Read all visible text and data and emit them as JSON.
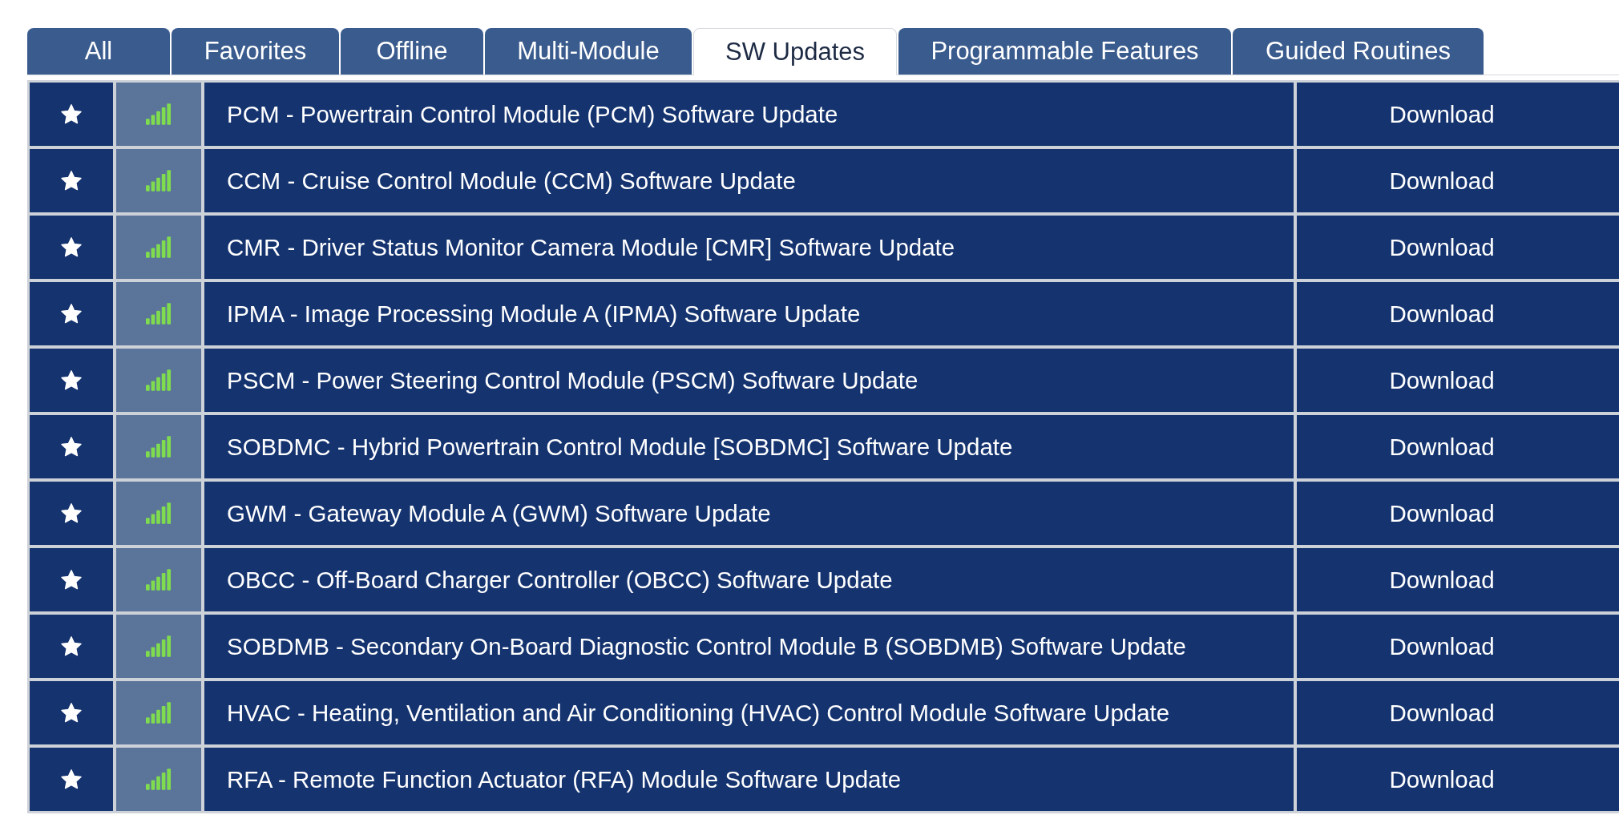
{
  "tabs": [
    {
      "label": "All",
      "selected": false
    },
    {
      "label": "Favorites",
      "selected": false
    },
    {
      "label": "Offline",
      "selected": false
    },
    {
      "label": "Multi-Module",
      "selected": false
    },
    {
      "label": "SW Updates",
      "selected": true
    },
    {
      "label": "Programmable Features",
      "selected": false
    },
    {
      "label": "Guided Routines",
      "selected": false
    }
  ],
  "rows": [
    {
      "name": "PCM - Powertrain Control Module (PCM) Software Update",
      "action": "Download"
    },
    {
      "name": "CCM - Cruise Control Module (CCM) Software Update",
      "action": "Download"
    },
    {
      "name": "CMR - Driver Status Monitor Camera Module [CMR] Software Update",
      "action": "Download"
    },
    {
      "name": "IPMA - Image Processing Module A (IPMA) Software Update",
      "action": "Download"
    },
    {
      "name": "PSCM - Power Steering Control Module (PSCM) Software Update",
      "action": "Download"
    },
    {
      "name": "SOBDMC - Hybrid Powertrain Control Module [SOBDMC] Software Update",
      "action": "Download"
    },
    {
      "name": "GWM - Gateway Module A (GWM) Software Update",
      "action": "Download"
    },
    {
      "name": "OBCC - Off-Board Charger Controller (OBCC) Software Update",
      "action": "Download"
    },
    {
      "name": "SOBDMB - Secondary On-Board Diagnostic Control Module B (SOBDMB) Software Update",
      "action": "Download"
    },
    {
      "name": "HVAC - Heating, Ventilation and Air Conditioning (HVAC) Control Module Software Update",
      "action": "Download"
    },
    {
      "name": "RFA - Remote Function Actuator (RFA) Module Software Update",
      "action": "Download"
    }
  ]
}
